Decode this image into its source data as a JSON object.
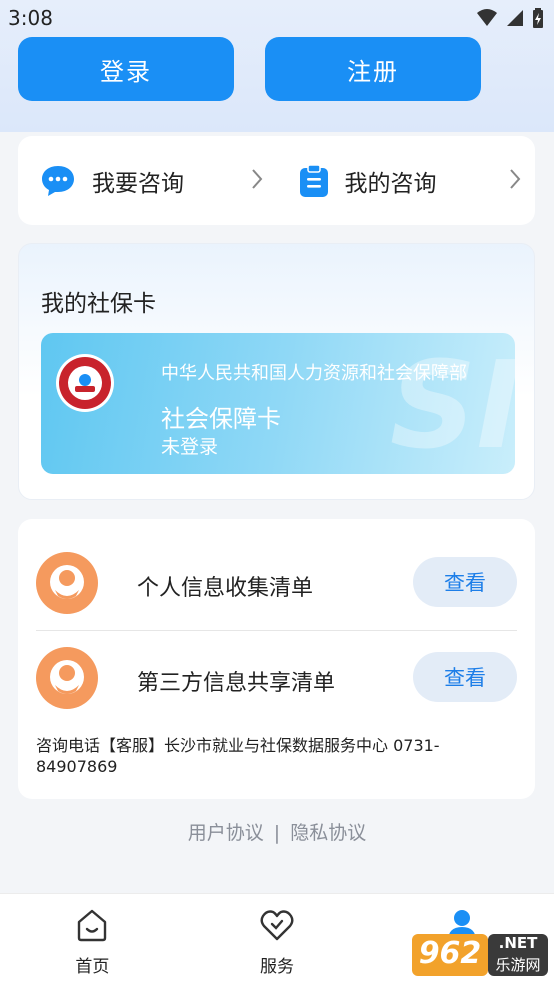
{
  "status_bar": {
    "time": "3:08"
  },
  "auth": {
    "login_label": "登录",
    "register_label": "注册"
  },
  "consult": {
    "ask_label": "我要咨询",
    "mine_label": "我的咨询"
  },
  "social_security": {
    "section_title": "我的社保卡",
    "org_name": "中华人民共和国人力资源和社会保障部",
    "card_name": "社会保障卡",
    "status": "未登录",
    "watermark": "SI"
  },
  "info_lists": {
    "items": [
      {
        "title": "个人信息收集清单",
        "action": "查看"
      },
      {
        "title": "第三方信息共享清单",
        "action": "查看"
      }
    ],
    "phone_note": "咨询电话【客服】长沙市就业与社保数据服务中心 0731-84907869"
  },
  "agreements": {
    "user": "用户协议",
    "separator": "|",
    "privacy": "隐私协议"
  },
  "tabbar": {
    "tabs": [
      {
        "label": "首页"
      },
      {
        "label": "服务"
      },
      {
        "label": "我的"
      }
    ]
  },
  "watermark_site": {
    "number": "962",
    "suffix": ".NET",
    "cn": "乐游网"
  },
  "colors": {
    "primary": "#1a8ff5",
    "accent_orange": "#f59a5e",
    "view_btn_bg": "#e3ecf7"
  }
}
